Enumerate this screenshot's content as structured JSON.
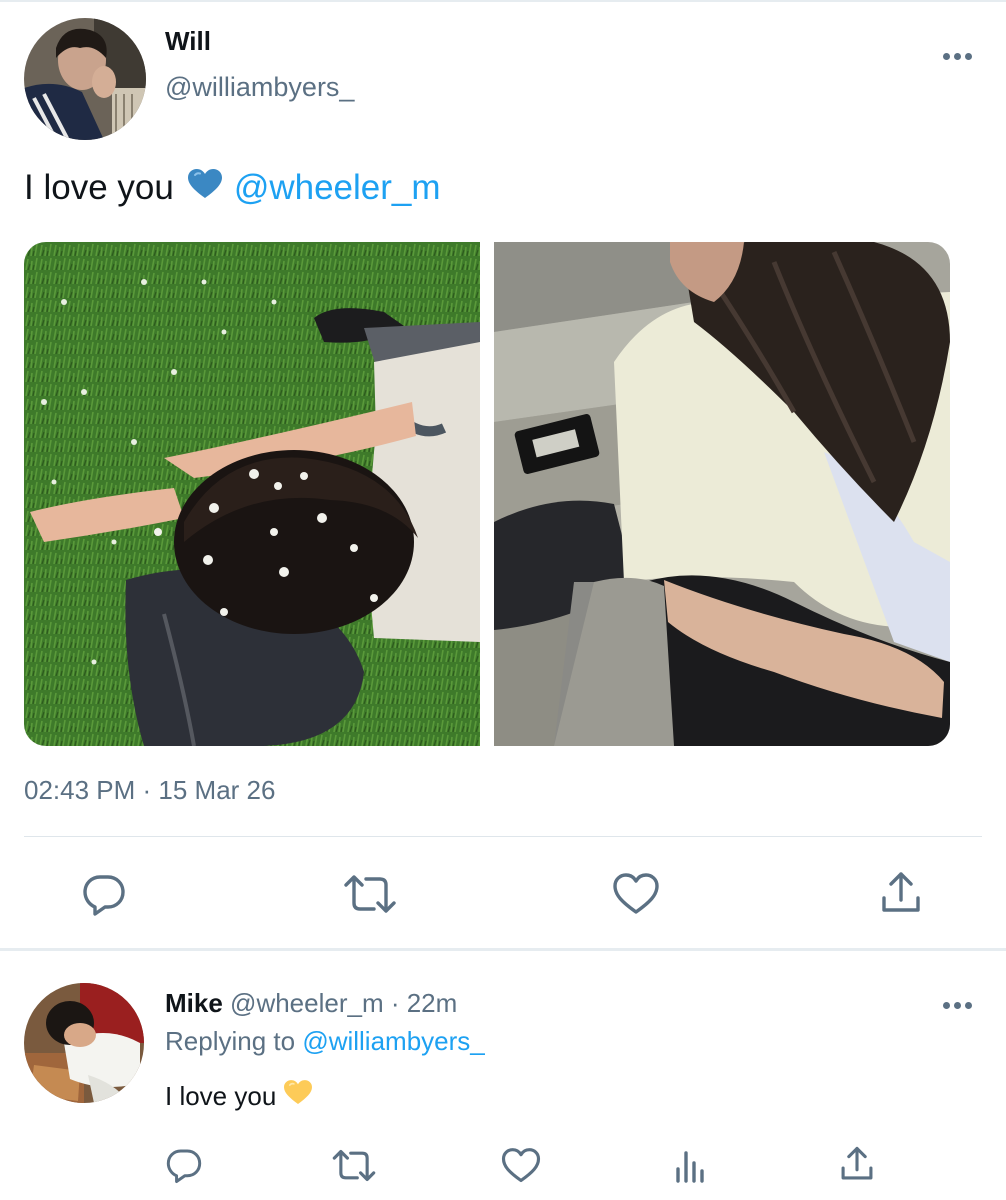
{
  "tweet": {
    "author_name": "Will",
    "author_handle": "@williambyers_",
    "text": "I love you",
    "emoji": "blue-heart",
    "mention": "@wheeler_m",
    "timestamp": "02:43 PM · 15 Mar 26",
    "actions": [
      "reply",
      "retweet",
      "like",
      "share"
    ]
  },
  "reply": {
    "author_name": "Mike",
    "meta": "@wheeler_m · 22m",
    "replying_prefix": "Replying to",
    "replying_to": "@williambyers_",
    "text": "I love you",
    "emoji": "yellow-heart",
    "actions": [
      "reply",
      "retweet",
      "like",
      "stats",
      "share"
    ]
  },
  "colors": {
    "link": "#1da1f2",
    "secondary_text": "#5b7083",
    "icon": "#5b7083",
    "divider": "#e6ecf0"
  }
}
